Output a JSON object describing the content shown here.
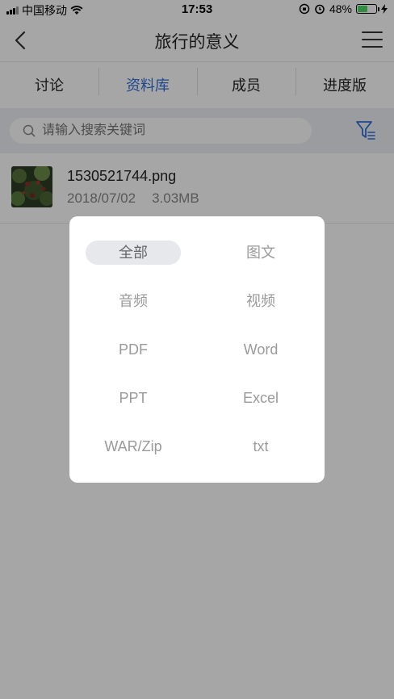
{
  "status_bar": {
    "carrier": "中国移动",
    "time": "17:53",
    "battery": "48%"
  },
  "nav": {
    "title": "旅行的意义"
  },
  "tabs": [
    {
      "label": "讨论"
    },
    {
      "label": "资料库"
    },
    {
      "label": "成员"
    },
    {
      "label": "进度版"
    }
  ],
  "search": {
    "placeholder": "请输入搜索关键词"
  },
  "files": [
    {
      "name": "1530521744.png",
      "date": "2018/07/02",
      "size": "3.03MB"
    }
  ],
  "filter_popup": {
    "options": [
      "全部",
      "图文",
      "音频",
      "视频",
      "PDF",
      "Word",
      "PPT",
      "Excel",
      "WAR/Zip",
      "txt"
    ],
    "selected": "全部"
  },
  "colors": {
    "accent": "#2f6fd6",
    "overlay": "rgba(0,0,0,0.35)",
    "battery": "#4cd964"
  }
}
